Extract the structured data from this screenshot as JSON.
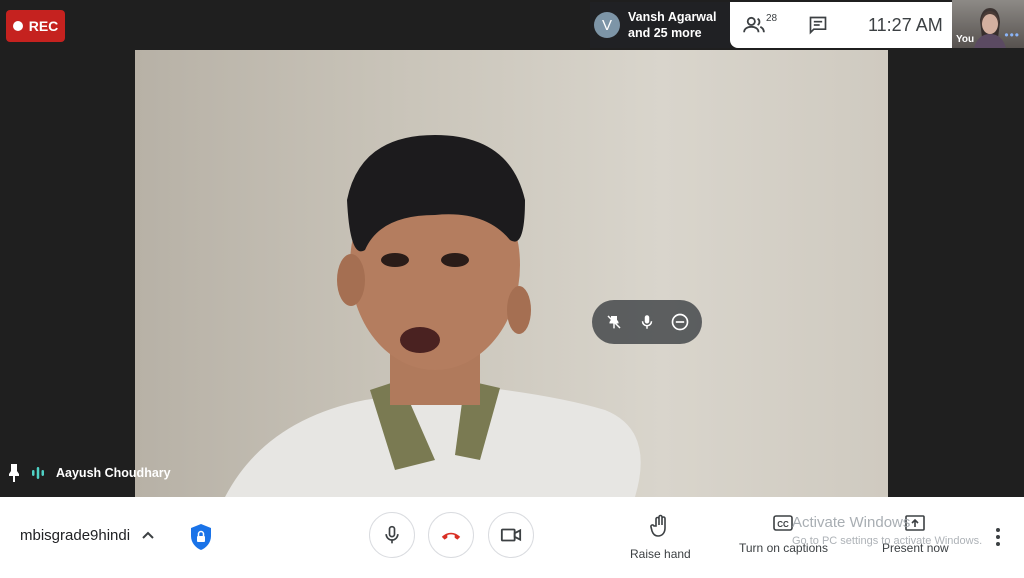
{
  "recording": {
    "label": "REC",
    "color": "#c5221f"
  },
  "participants_chip": {
    "avatar_letter": "V",
    "name": "Vansh Agarwal",
    "more_text": "and 25 more"
  },
  "top_bar": {
    "participant_count": "28",
    "time": "11:27 AM",
    "people_icon": "people-icon",
    "chat_icon": "chat-icon"
  },
  "self_tile": {
    "label": "You"
  },
  "main_tile": {
    "speaker_name": "Aayush Choudhary"
  },
  "bottom_bar": {
    "meeting_name": "mbisgrade9hindi",
    "raise_hand_label": "Raise hand",
    "captions_label": "Turn on captions",
    "present_label": "Present now"
  },
  "watermark": {
    "title": "Activate Windows",
    "subtitle": "Go to PC settings to activate Windows."
  },
  "colors": {
    "accent": "#1a73e8",
    "hangup": "#d93025",
    "speaking": "#4fd1c5"
  }
}
